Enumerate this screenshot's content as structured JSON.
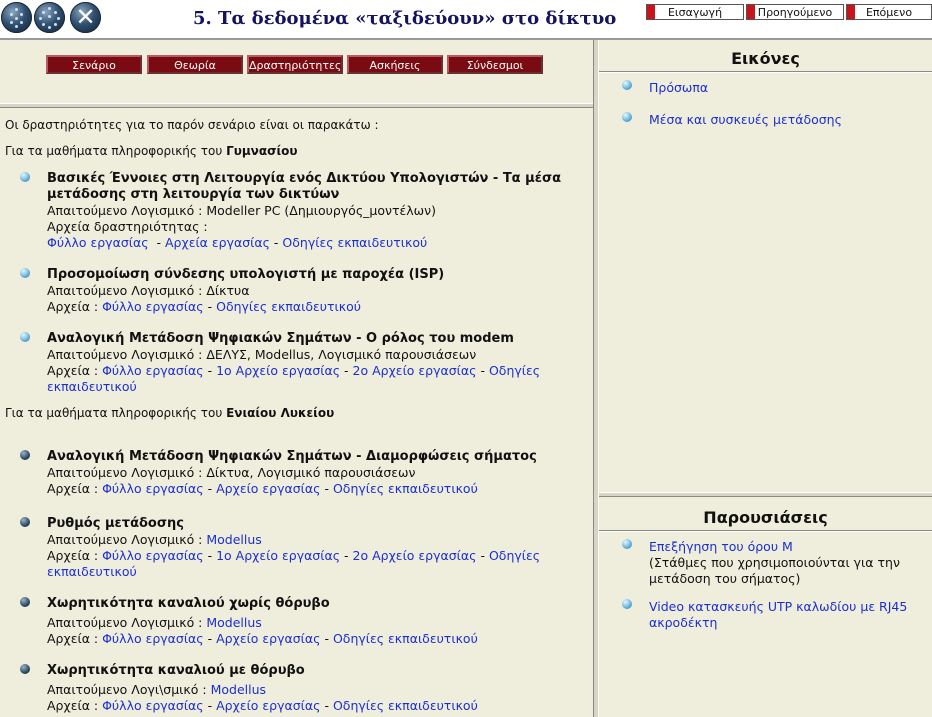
{
  "header": {
    "title": "5. Τα δεδομένα «ταξιδεύουν» στο δίκτυο",
    "nav": {
      "home": "Εισαγωγή",
      "prev": "Προηγούμενο",
      "next": "Επόμενο"
    }
  },
  "tabs": [
    "Σενάριο",
    "Θεωρία",
    "Δραστηριότητες",
    "Ασκήσεις",
    "Σύνδεσμοι"
  ],
  "main": {
    "intro": "Οι δραστηριότητες για το παρόν σενάριο είναι οι παρακάτω :",
    "section1": {
      "prefix": "Για τα μαθήματα πληροφορικής του ",
      "name": "Γυμνασίου"
    },
    "section2": {
      "prefix": "Για τα μαθήματα πληροφορικής του ",
      "name": "Ενιαίου Λυκείου"
    },
    "labels": {
      "software": "Απαιτούμενο Λογισμικό : ",
      "software_alt": "Απαιτούμενο Λογι\\σμικό : ",
      "files": "Αρχεία : ",
      "files_act": "Αρχεία δραστηριότητας :",
      "sep": " - "
    },
    "items1": [
      {
        "title": "Βασικές Έννοιες στη Λειτουργία ενός Δικτύου Υπολογιστών - Τα μέσα μετάδοσης στη λειτουργία των δικτύων",
        "software": "Modeller PC (Δημιουργός_μοντέλων)",
        "links": [
          "Φύλλο εργασίας",
          "Αρχεία εργασίας",
          "Οδηγίες εκπαιδευτικού"
        ]
      },
      {
        "title": "Προσομοίωση σύνδεσης υπολογιστή με παροχέα (ISP)",
        "software": "Δίκτυα",
        "links": [
          "Φύλλο εργασίας",
          "Οδηγίες εκπαιδευτικού"
        ]
      },
      {
        "title": "Αναλογική Μετάδοση Ψηφιακών Σημάτων - Ο ρόλος του modem",
        "software": "ΔΕΛΥΣ, Modellus,  Λογισμικό παρουσιάσεων",
        "links": [
          "Φύλλο εργασίας",
          "1ο Αρχείο εργασίας",
          "2ο Αρχείο εργασίας",
          "Οδηγίες",
          "εκπαιδευτικού"
        ]
      }
    ],
    "items2": [
      {
        "title": "Αναλογική Μετάδοση Ψηφιακών Σημάτων - Διαμορφώσεις σήματος",
        "software": "Δίκτυα, Λογισμικό παρουσιάσεων",
        "links": [
          "Φύλλο εργασίας",
          "Αρχείο εργασίας",
          "Οδηγίες εκπαιδευτικού"
        ]
      },
      {
        "title": "Ρυθμός μετάδοσης",
        "software": "Modellus",
        "links": [
          "Φύλλο εργασίας",
          "1ο Αρχείο εργασίας",
          "2ο Αρχείο εργασίας",
          "Οδηγίες",
          "εκπαιδευτικού"
        ]
      },
      {
        "title": "Χωρητικότητα καναλιού χωρίς θόρυβο",
        "software": "Modellus",
        "links": [
          "Φύλλο εργασίας",
          "Αρχείο εργασίας",
          "Οδηγίες εκπαιδευτικού"
        ]
      },
      {
        "title": "Χωρητικότητα καναλιού με θόρυβο",
        "software": "Modellus",
        "links": [
          "Φύλλο εργασίας",
          "Αρχείο εργασίας",
          "Οδηγίες εκπαιδευτικού"
        ]
      }
    ]
  },
  "images": {
    "heading": "Εικόνες",
    "items": [
      "Πρόσωπα",
      "Μέσα και συσκευές μετάδοσης"
    ]
  },
  "presentations": {
    "heading": "Παρουσιάσεις",
    "items": [
      {
        "link": "Επεξήγηση του όρου Μ",
        "note": "(Στάθμες που χρησιμοποιούνται για την μετάδοση του σήματος)"
      },
      {
        "link": "Video κατασκευής UTP καλωδίου με RJ45 ακροδέκτη",
        "note": ""
      }
    ]
  },
  "colors": {
    "accent": "#7b0b12",
    "link": "#1b2fd1",
    "title": "#13135f",
    "background": "#efeedd"
  }
}
